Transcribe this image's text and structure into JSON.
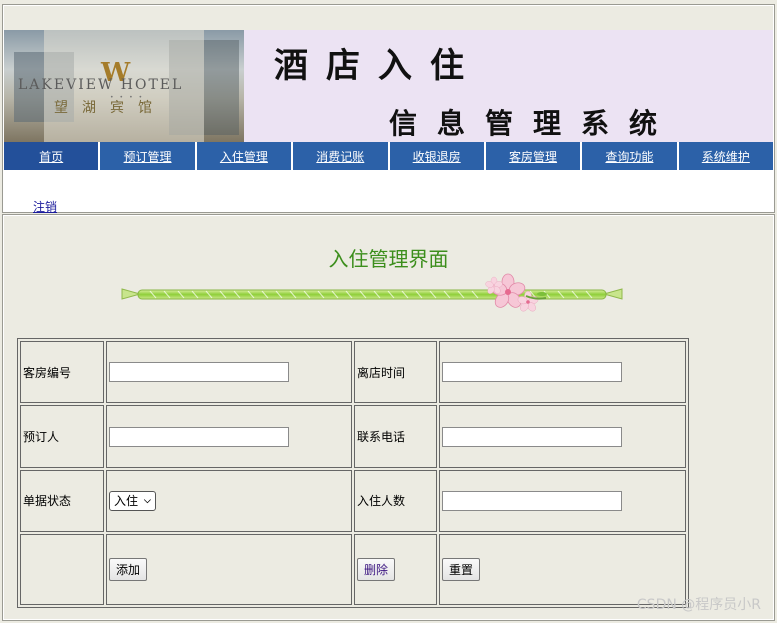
{
  "banner": {
    "logo_mark": "W",
    "logo_text": "LAKEVIEW HOTEL",
    "logo_cn": "望湖宾馆",
    "title_line1": "酒店入住",
    "title_line2": "信息管理系统"
  },
  "nav": {
    "items": [
      "首页",
      "预订管理",
      "入住管理",
      "消费记账",
      "收银退房",
      "客房管理",
      "查询功能",
      "系统维护"
    ],
    "logout": "注销"
  },
  "page": {
    "title": "入住管理界面"
  },
  "form": {
    "room_no_label": "客房编号",
    "room_no_value": "",
    "leave_time_label": "离店时间",
    "leave_time_value": "",
    "booker_label": "预订人",
    "booker_value": "",
    "phone_label": "联系电话",
    "phone_value": "",
    "status_label": "单据状态",
    "status_selected": "入住",
    "guest_count_label": "入住人数",
    "guest_count_value": "",
    "add_button": "添加",
    "delete_button": "删除",
    "reset_button": "重置"
  },
  "watermark": "CSDN @程序员小R",
  "colors": {
    "nav_bg": "#2c61a8",
    "title_green": "#3c8e1c",
    "page_bg": "#ecebe2",
    "banner_bg": "#ece3f3"
  }
}
